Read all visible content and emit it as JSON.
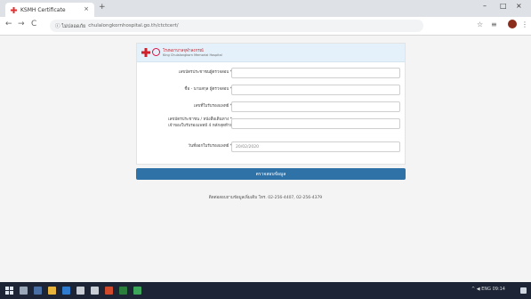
{
  "browser": {
    "tab_title": "KSMH Certificate",
    "tab_close": "×",
    "new_tab": "+",
    "window_controls": [
      "–",
      "□",
      "×"
    ],
    "nav": [
      "←",
      "→",
      "C"
    ],
    "security_label": "ⓘ ไม่ปลอดภัย",
    "url": "chulalongkornhospital.go.th/ctctcert/",
    "toolbar_icons": [
      "☆",
      "≡",
      "⋮"
    ]
  },
  "form": {
    "header_title": "โรงพยาบาลจุฬาลงกรณ์",
    "header_subtitle": "King Chulalongkorn Memorial Hospital",
    "fields": [
      {
        "label": "เลขบัตรประชาชนผู้ตรวจสอบ *",
        "value": ""
      },
      {
        "label": "ชื่อ - นามสกุล ผู้ตรวจสอบ *",
        "value": ""
      },
      {
        "label": "เลขที่ใบรับรองแพทย์ *",
        "value": ""
      },
      {
        "label": "เลขบัตรประชาชน / หนังสือเดินทาง *",
        "label2": "เจ้าของใบรับรองแพทย์ 4 หลักสุดท้าย",
        "value": ""
      },
      {
        "label": "วันที่ออกใบรับรองแพทย์ *",
        "value": "20/02/2020"
      }
    ],
    "submit_label": "ตรวจสอบข้อมูล",
    "contact": "ติดต่อสอบถามข้อมูลเพิ่มเติม โทร. 02-256-4407, 02-256-4379"
  },
  "taskbar": {
    "tray": "^  ◀  ENG  09:14"
  }
}
